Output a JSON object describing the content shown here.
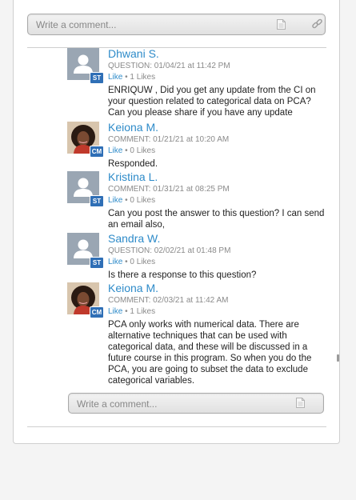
{
  "top_comment": {
    "placeholder": "Write a comment..."
  },
  "bottom_comment": {
    "placeholder": "Write a comment..."
  },
  "posts": [
    {
      "name": "Dhwani S.",
      "type": "QUESTION",
      "timestamp": "01/04/21 at 11:42 PM",
      "like_label": "Like",
      "likes": "1 Likes",
      "badge": "ST",
      "avatar": "default",
      "text": "ENRIQUW , Did you get any update from the CI on your question related to categorical data on PCA? Can you please share if you have any update"
    },
    {
      "name": "Keiona M.",
      "type": "COMMENT",
      "timestamp": "01/21/21 at 10:20 AM",
      "like_label": "Like",
      "likes": "0 Likes",
      "badge": "CM",
      "avatar": "photo",
      "text": "Responded."
    },
    {
      "name": "Kristina L.",
      "type": "COMMENT",
      "timestamp": "01/31/21 at 08:25 PM",
      "like_label": "Like",
      "likes": "0 Likes",
      "badge": "ST",
      "avatar": "default",
      "text": "Can you post the answer to this question? I can send an email also,"
    },
    {
      "name": "Sandra W.",
      "type": "QUESTION",
      "timestamp": "02/02/21 at 01:48 PM",
      "like_label": "Like",
      "likes": "0 Likes",
      "badge": "ST",
      "avatar": "default",
      "text": "Is there a response to this question?"
    },
    {
      "name": "Keiona M.",
      "type": "COMMENT",
      "timestamp": "02/03/21 at 11:42 AM",
      "like_label": "Like",
      "likes": "1 Likes",
      "badge": "CM",
      "avatar": "photo",
      "text": "PCA only works with numerical data. There are alternative techniques that can be used with categorical data, and these will be discussed in a future course in this program. So when you do the PCA, you are going to subset the data to exclude categorical variables."
    }
  ],
  "colors": {
    "name_link": "#2e8bc9",
    "badge": "#2f6fb6",
    "meta": "#8a8a8a"
  },
  "icons": {
    "attach_file": "document-icon",
    "attach_link": "link-icon"
  }
}
